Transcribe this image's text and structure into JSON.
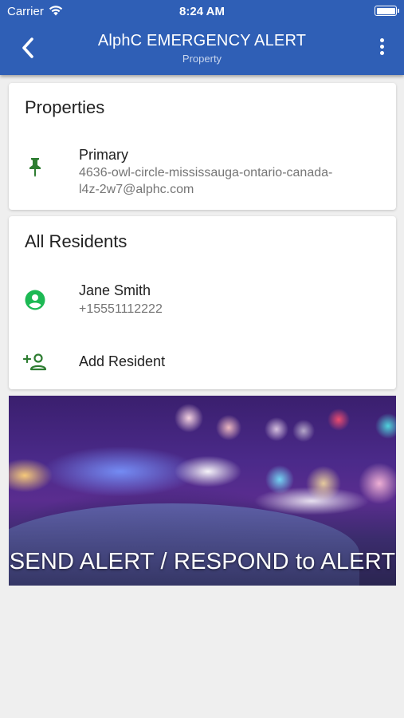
{
  "status_bar": {
    "carrier": "Carrier",
    "time": "8:24 AM"
  },
  "header": {
    "title": "AlphC EMERGENCY ALERT",
    "subtitle": "Property"
  },
  "properties": {
    "heading": "Properties",
    "items": [
      {
        "name": "Primary",
        "address_line1": "4636-owl-circle-mississauga-ontario-canada-",
        "address_line2": "l4z-2w7@alphc.com",
        "icon": "pin-icon"
      }
    ]
  },
  "residents": {
    "heading": "All Residents",
    "items": [
      {
        "name": "Jane Smith",
        "phone": "+15551112222",
        "icon": "account-circle-icon"
      }
    ],
    "add_label": "Add Resident"
  },
  "alert_banner": {
    "label": "SEND ALERT / RESPOND to ALERT"
  },
  "colors": {
    "header_bg": "#2f5fb6",
    "pin_green": "#2e7d32",
    "account_green": "#1db954",
    "page_bg": "#efefef"
  }
}
